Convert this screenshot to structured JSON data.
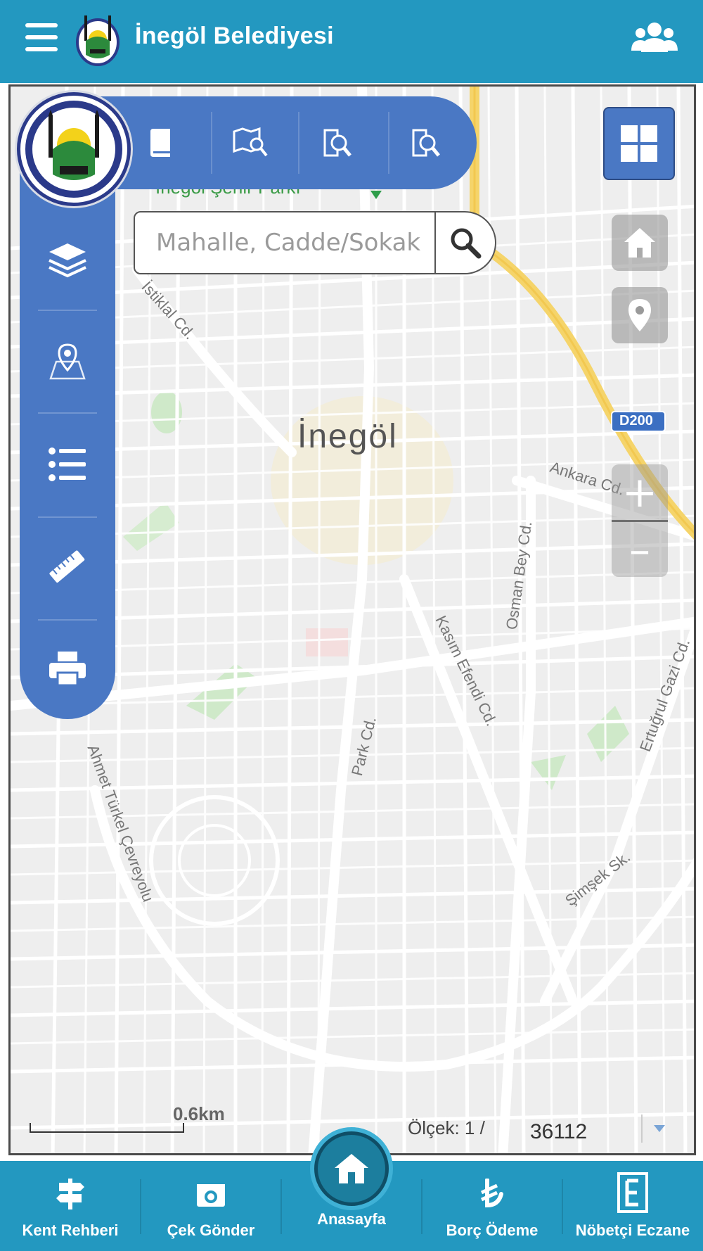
{
  "header": {
    "title": "İnegöl Belediyesi",
    "menu_icon": "hamburger-menu-icon",
    "logo": "inegol-municipality-logo",
    "account_icon": "users-icon",
    "color": "#2398c0"
  },
  "map": {
    "city_label": "İnegöl",
    "road_shield": "D200",
    "street_labels": {
      "istiklal": "İstiklal Cd.",
      "ankara": "Ankara Cd.",
      "osman_bey": "Osman Bey Cd.",
      "kasim_efendi": "Kasım Efendi Cd.",
      "park": "Park Cd.",
      "ahmet_turkel": "Ahmet Türkel Çevreyolu",
      "ertugrul_gazi": "Ertuğrul Gazi Cd.",
      "simsek": "Şimşek Sk.",
      "park_name": "İnegöl Şehir Parkı"
    },
    "scale": {
      "distance": "0.6km",
      "label": "Ölçek: 1 /",
      "value": "36112"
    }
  },
  "toolbar": {
    "top_items": [
      "book-icon",
      "map-search-icon",
      "search-document-icon",
      "search-document-alt-icon"
    ],
    "side_items": [
      "layers-icon",
      "map-pin-icon",
      "list-icon",
      "ruler-icon",
      "printer-icon"
    ],
    "color": "#4a78c4"
  },
  "search": {
    "placeholder": "Mahalle, Cadde/Sokak"
  },
  "bottom_nav": {
    "items": [
      {
        "label": "Kent Rehberi",
        "icon": "signpost-icon"
      },
      {
        "label": "Çek Gönder",
        "icon": "camera-icon"
      },
      {
        "label": "Anasayfa",
        "icon": "home-icon"
      },
      {
        "label": "Borç Ödeme",
        "icon": "lira-icon"
      },
      {
        "label": "Nöbetçi Eczane",
        "icon": "pharmacy-e-icon"
      }
    ]
  }
}
